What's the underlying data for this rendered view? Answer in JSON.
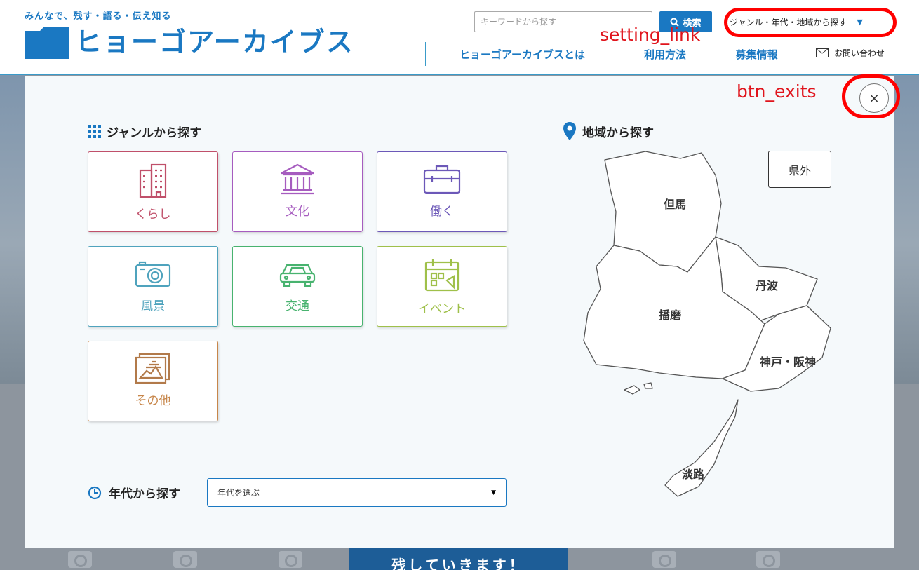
{
  "header": {
    "tagline": "みんなで、残す・語る・伝え知る",
    "logo_text": "ヒョーゴアーカイブス",
    "search_placeholder": "キーワードから探す",
    "search_button": "検索",
    "genre_link": "ジャンル・年代・地域から探す",
    "nav": [
      "ヒョーゴアーカイブスとは",
      "利用方法",
      "募集情報"
    ],
    "contact": "お問い合わせ"
  },
  "annotations": {
    "setting_link": "setting_link",
    "btn_exits": "btn_exits"
  },
  "modal": {
    "close_label": "×",
    "genre_title": "ジャンルから探す",
    "genres": [
      {
        "label": "くらし",
        "icon": "building-icon",
        "color": "#c0506a"
      },
      {
        "label": "文化",
        "icon": "museum-icon",
        "color": "#a65cbf"
      },
      {
        "label": "働く",
        "icon": "briefcase-icon",
        "color": "#6c58b8"
      },
      {
        "label": "風景",
        "icon": "camera-icon",
        "color": "#4fa3bd"
      },
      {
        "label": "交通",
        "icon": "car-icon",
        "color": "#48b36f"
      },
      {
        "label": "イベント",
        "icon": "calendar-icon",
        "color": "#9fc04a"
      },
      {
        "label": "その他",
        "icon": "photo-icon",
        "color": "#c7864a"
      }
    ],
    "region_title": "地域から探す",
    "outside_prefecture": "県外",
    "regions": [
      "但馬",
      "丹波",
      "播磨",
      "神戸・阪神",
      "淡路"
    ],
    "era_title": "年代から探す",
    "era_placeholder": "年代を選ぶ"
  },
  "footer": {
    "banner_text": "残していきます！"
  },
  "colors": {
    "brand": "#1a78c2",
    "annotation": "#e0141c"
  }
}
